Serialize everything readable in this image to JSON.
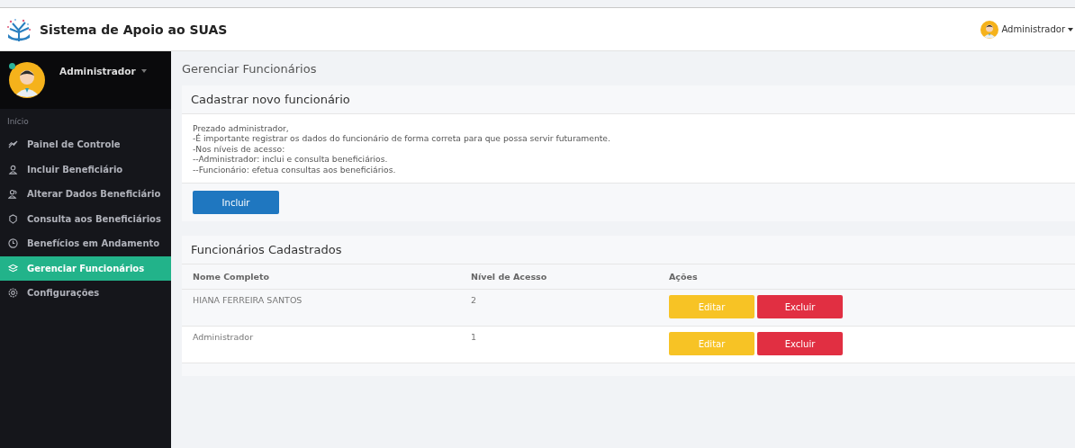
{
  "header": {
    "title": "Sistema de Apoio ao SUAS",
    "user": "Administrador"
  },
  "sidebar": {
    "user": "Administrador",
    "online": true,
    "section": "Início",
    "items": [
      {
        "label": "Painel de Controle",
        "selected": false
      },
      {
        "label": "Incluir Beneficiário",
        "selected": false
      },
      {
        "label": "Alterar Dados Beneficiário",
        "selected": false
      },
      {
        "label": "Consulta aos Beneficiários",
        "selected": false
      },
      {
        "label": "Benefícios em Andamento",
        "selected": false
      },
      {
        "label": "Gerenciar Funcionários",
        "selected": true
      },
      {
        "label": "Configurações",
        "selected": false
      }
    ]
  },
  "page_title": "Gerenciar Funcionários",
  "register_panel": {
    "title": "Cadastrar novo funcionário",
    "lines": [
      "Prezado administrador,",
      "-É importante registrar os dados do funcionário de forma correta para que possa servir futuramente.",
      "-Nos níveis de acesso:",
      "--Administrador: inclui e consulta beneficiários.",
      "--Funcionário: efetua consultas aos beneficiários."
    ],
    "button": "Incluir"
  },
  "table_panel": {
    "title": "Funcionários Cadastrados",
    "columns": [
      "Nome Completo",
      "Nível de Acesso",
      "Ações"
    ],
    "rows": [
      {
        "name": "HIANA FERREIRA SANTOS",
        "level": "2",
        "edit": "Editar",
        "delete": "Excluir"
      },
      {
        "name": "Administrador",
        "level": "1",
        "edit": "Editar",
        "delete": "Excluir"
      }
    ]
  }
}
